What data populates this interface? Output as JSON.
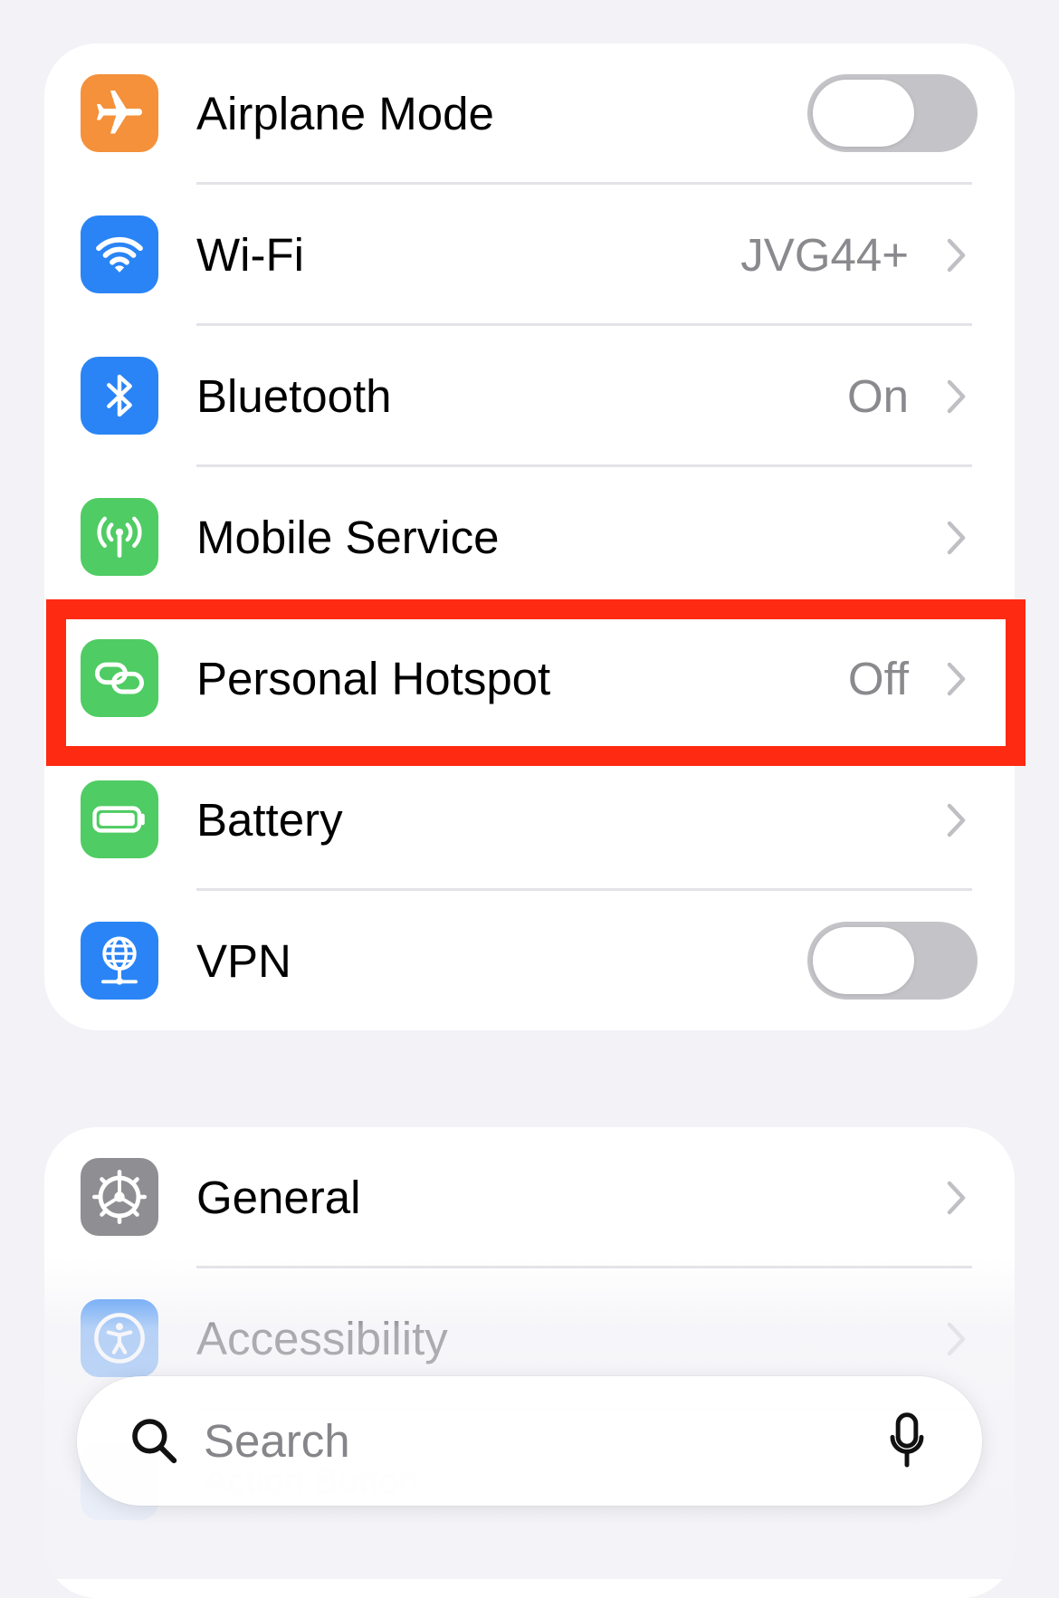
{
  "colors": {
    "background": "#f2f2f7",
    "card": "#ffffff",
    "highlight_border": "#ff2a12",
    "secondary_text": "#8a8a8e",
    "toggle_off": "#c4c4c8"
  },
  "group1": {
    "rows": [
      {
        "label": "Airplane Mode",
        "icon": "airplane-icon",
        "icon_color": "#f4913a",
        "control": "toggle",
        "toggle_on": false
      },
      {
        "label": "Wi-Fi",
        "icon": "wifi-icon",
        "icon_color": "#2a84f5",
        "value": "JVG44+",
        "control": "chevron"
      },
      {
        "label": "Bluetooth",
        "icon": "bluetooth-icon",
        "icon_color": "#2a84f5",
        "value": "On",
        "control": "chevron"
      },
      {
        "label": "Mobile Service",
        "icon": "antenna-icon",
        "icon_color": "#4fcc63",
        "control": "chevron"
      },
      {
        "label": "Personal Hotspot",
        "icon": "link-icon",
        "icon_color": "#4fcc63",
        "value": "Off",
        "control": "chevron",
        "highlighted": true
      },
      {
        "label": "Battery",
        "icon": "battery-icon",
        "icon_color": "#4fcc63",
        "control": "chevron"
      },
      {
        "label": "VPN",
        "icon": "globe-network-icon",
        "icon_color": "#2a84f5",
        "control": "toggle",
        "toggle_on": false
      }
    ]
  },
  "group2": {
    "rows": [
      {
        "label": "General",
        "icon": "gear-icon",
        "icon_color": "#8e8e93",
        "control": "chevron"
      },
      {
        "label": "Accessibility",
        "icon": "accessibility-icon",
        "icon_color": "#2a84f5",
        "control": "chevron"
      }
    ],
    "partially_hidden_row": {
      "label": "Action Button",
      "icon": "action-button-icon",
      "icon_color": "#2a84f5"
    }
  },
  "search": {
    "placeholder": "Search",
    "icon": "search-icon",
    "mic_icon": "microphone-icon"
  }
}
